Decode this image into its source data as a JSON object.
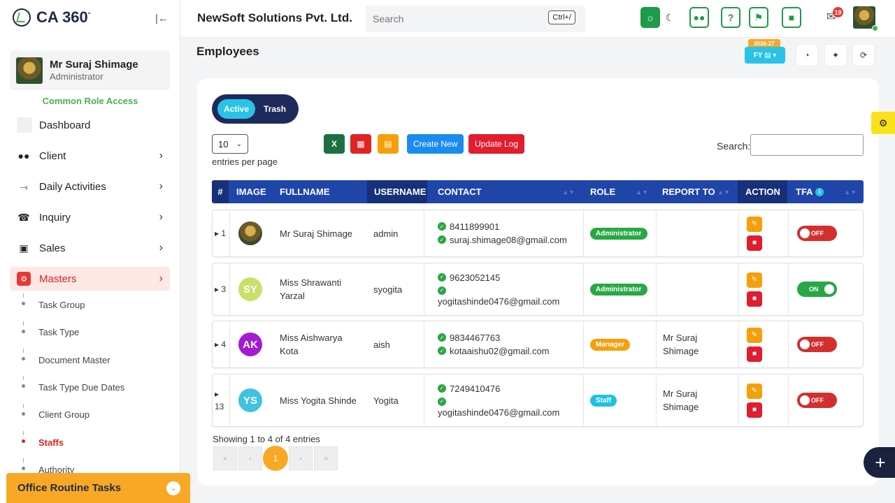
{
  "brand": {
    "name": "CA 360",
    "mark": "°"
  },
  "user": {
    "name": "Mr Suraj Shimage",
    "role": "Administrator"
  },
  "sidebar": {
    "role_access": "Common Role Access",
    "items": [
      {
        "label": "Dashboard",
        "icon": "dashboard-icon"
      },
      {
        "label": "Client",
        "icon": "users-icon"
      },
      {
        "label": "Daily Activities",
        "icon": "pin-icon"
      },
      {
        "label": "Inquiry",
        "icon": "phone-icon"
      },
      {
        "label": "Sales",
        "icon": "cash-icon"
      },
      {
        "label": "Masters",
        "icon": "gears-icon"
      }
    ],
    "sub_items": [
      "Task Group",
      "Task Type",
      "Document Master",
      "Task Type Due Dates",
      "Client Group",
      "Staffs",
      "Authority"
    ],
    "active_sub": "Staffs",
    "office_bar": "Office Routine Tasks"
  },
  "topbar": {
    "company": "NewSoft Solutions Pvt. Ltd.",
    "search_placeholder": "Search",
    "shortcut": "Ctrl+/",
    "notification_count": "19",
    "accent": "#1d9b48"
  },
  "page": {
    "title": "Employees",
    "fy_year": "2026-27",
    "fy_label": "FY ▤ ▾"
  },
  "list": {
    "tab_active": "Active",
    "tab_trash": "Trash",
    "entries_value": "10",
    "entries_label": "entries per page",
    "create_new": "Create New",
    "update_log": "Update Log",
    "search_label": "Search:",
    "columns": [
      "#",
      "IMAGE",
      "FULLNAME",
      "USERNAME",
      "CONTACT",
      "ROLE",
      "REPORT TO",
      "ACTION",
      "TFA"
    ],
    "rows": [
      {
        "num": "1",
        "initials": "",
        "avatar_color": "photo",
        "fullname": "Mr Suraj Shimage",
        "username": "admin",
        "phone": "8411899901",
        "email": "suraj.shimage08@gmail.com",
        "role": "Administrator",
        "role_color": "#28a745",
        "report_to": "",
        "tfa": "OFF"
      },
      {
        "num": "3",
        "initials": "SY",
        "avatar_color": "#c7e06a",
        "fullname": "Miss Shrawanti Yarzal",
        "username": "syogita",
        "phone": "9623052145",
        "email": "yogitashinde0476@gmail.com",
        "role": "Administrator",
        "role_color": "#28a745",
        "report_to": "",
        "tfa": "ON"
      },
      {
        "num": "4",
        "initials": "AK",
        "avatar_color": "#a21ad6",
        "fullname": "Miss Aishwarya Kota",
        "username": "aish",
        "phone": "9834467763",
        "email": "kotaaishu02@gmail.com",
        "role": "Manager",
        "role_color": "#f5a00a",
        "report_to": "Mr Suraj Shimage",
        "tfa": "OFF"
      },
      {
        "num": "13",
        "initials": "YS",
        "avatar_color": "#3ec3e0",
        "fullname": "Miss Yogita Shinde",
        "username": "Yogita",
        "phone": "7249410476",
        "email": "yogitashinde0476@gmail.com",
        "role": "Staff",
        "role_color": "#1ec0e6",
        "report_to": "Mr Suraj Shimage",
        "tfa": "OFF"
      }
    ],
    "showing": "Showing 1 to 4 of 4 entries",
    "current_page": "1"
  }
}
